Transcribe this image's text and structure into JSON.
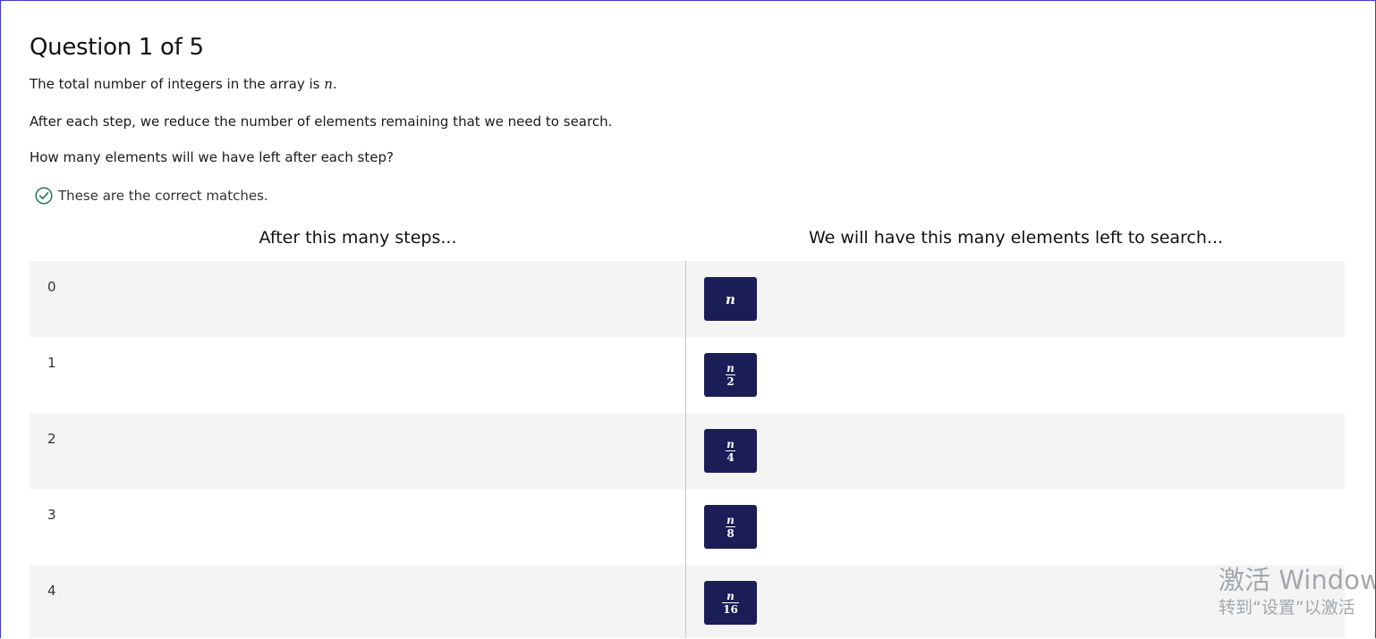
{
  "question": {
    "title": "Question 1 of 5",
    "paragraph1_prefix": "The total number of integers in the array is ",
    "paragraph1_var": "n",
    "paragraph1_suffix": ".",
    "paragraph2": "After each step, we reduce the number of elements remaining that we need to search.",
    "paragraph3": "How many elements will we have left after each step?"
  },
  "feedback": {
    "icon": "check-circle-icon",
    "text": "These are the correct matches.",
    "color": "#2e7d5b"
  },
  "table": {
    "left_header": "After this many steps...",
    "right_header": "We will have this many elements left to search...",
    "rows": [
      {
        "steps": "0",
        "answer_num": "n",
        "answer_den": ""
      },
      {
        "steps": "1",
        "answer_num": "n",
        "answer_den": "2"
      },
      {
        "steps": "2",
        "answer_num": "n",
        "answer_den": "4"
      },
      {
        "steps": "3",
        "answer_num": "n",
        "answer_den": "8"
      },
      {
        "steps": "4",
        "answer_num": "n",
        "answer_den": "16"
      }
    ]
  },
  "watermark": {
    "line1": "激活 Window",
    "line2": "转到“设置”以激活"
  },
  "colors": {
    "chip": "#1b1d57",
    "row_shade": "#f4f4f4",
    "frame_border": "#3b3bd6"
  }
}
